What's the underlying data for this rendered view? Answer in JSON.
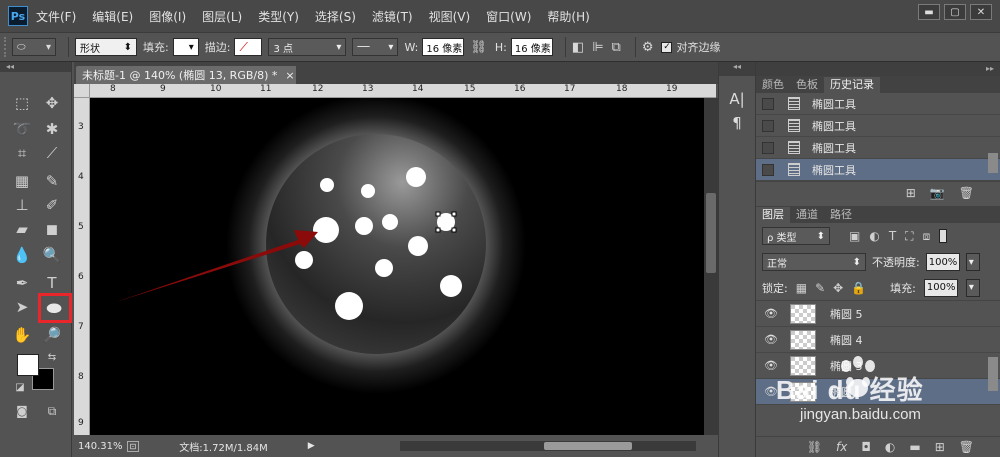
{
  "app": {
    "logo": "Ps"
  },
  "menu": [
    "文件(F)",
    "编辑(E)",
    "图像(I)",
    "图层(L)",
    "类型(Y)",
    "选择(S)",
    "滤镜(T)",
    "视图(V)",
    "窗口(W)",
    "帮助(H)"
  ],
  "window_controls": [
    "▬",
    "▢",
    "✕"
  ],
  "options": {
    "mode": "形状",
    "fill_label": "填充:",
    "stroke_label": "描边:",
    "stroke_width": "3 点",
    "w_label": "W:",
    "w_value": "16 像素",
    "h_label": "H:",
    "h_value": "16 像素",
    "align_edges": "对齐边缘"
  },
  "document": {
    "tab_title": "未标题-1 @ 140% (椭圆 13, RGB/8) *",
    "close": "×",
    "zoom": "140.31%",
    "doc_size": "文档:1.72M/1.84M"
  },
  "ruler": {
    "top": [
      "8",
      "9",
      "10",
      "11",
      "12",
      "13",
      "14",
      "15",
      "16",
      "17",
      "18",
      "19"
    ],
    "left": [
      "3",
      "4",
      "5",
      "6",
      "7",
      "8",
      "9"
    ]
  },
  "panel_top": {
    "tabs": [
      "颜色",
      "色板",
      "历史记录"
    ],
    "active_tab": "历史记录",
    "history": [
      "椭圆工具",
      "椭圆工具",
      "椭圆工具",
      "椭圆工具"
    ]
  },
  "layers_panel": {
    "tabs": [
      "图层",
      "通道",
      "路径"
    ],
    "active_tab": "图层",
    "filter": "ρ 类型",
    "blend_mode": "正常",
    "opacity_label": "不透明度:",
    "opacity": "100%",
    "lock_label": "锁定:",
    "fill_label": "填充:",
    "fill": "100%",
    "layers": [
      "椭圆 5",
      "椭圆 4",
      "椭圆 3",
      "椭圆"
    ]
  },
  "watermark": {
    "brand": "Bai du 经验",
    "url": "jingyan.baidu.com"
  },
  "colors": {
    "accent_select": "#5e6e86",
    "highlight_box": "#e8262b",
    "arrow": "#8b0a0a"
  }
}
